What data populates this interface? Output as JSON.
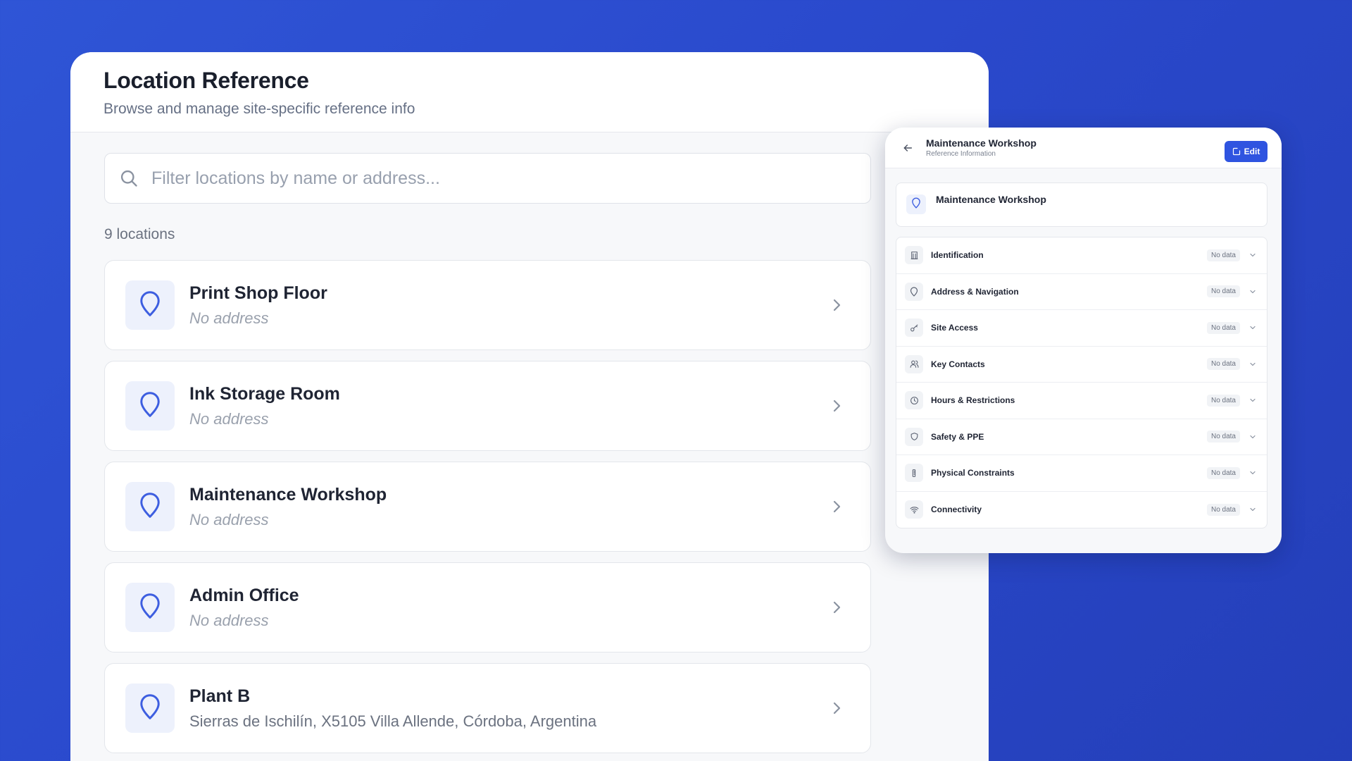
{
  "colors": {
    "accent": "#2f54e0",
    "background": "#2a49cc",
    "pin_icon": "#3d5ee0",
    "muted_text": "#9aa1ad"
  },
  "main": {
    "title": "Location Reference",
    "subtitle": "Browse and manage site-specific reference info",
    "search": {
      "value": "",
      "placeholder": "Filter locations by name or address...",
      "icon": "search-icon"
    },
    "count_label": "9 locations",
    "locations": [
      {
        "name": "Print Shop Floor",
        "address": "No address",
        "has_address": false
      },
      {
        "name": "Ink Storage Room",
        "address": "No address",
        "has_address": false
      },
      {
        "name": "Maintenance Workshop",
        "address": "No address",
        "has_address": false
      },
      {
        "name": "Admin Office",
        "address": "No address",
        "has_address": false
      },
      {
        "name": "Plant B",
        "address": "Sierras de Ischilín, X5105 Villa Allende, Córdoba, Argentina",
        "has_address": true
      }
    ]
  },
  "detail": {
    "title": "Maintenance Workshop",
    "subtitle": "Reference Information",
    "edit_label": "Edit",
    "location_name": "Maintenance Workshop",
    "sections": [
      {
        "label": "Identification",
        "badge": "No data",
        "icon": "building-icon"
      },
      {
        "label": "Address & Navigation",
        "badge": "No data",
        "icon": "map-pin-icon"
      },
      {
        "label": "Site Access",
        "badge": "No data",
        "icon": "key-icon"
      },
      {
        "label": "Key Contacts",
        "badge": "No data",
        "icon": "users-icon"
      },
      {
        "label": "Hours & Restrictions",
        "badge": "No data",
        "icon": "clock-icon"
      },
      {
        "label": "Safety & PPE",
        "badge": "No data",
        "icon": "shield-icon"
      },
      {
        "label": "Physical Constraints",
        "badge": "No data",
        "icon": "ruler-icon"
      },
      {
        "label": "Connectivity",
        "badge": "No data",
        "icon": "wifi-icon"
      }
    ]
  }
}
